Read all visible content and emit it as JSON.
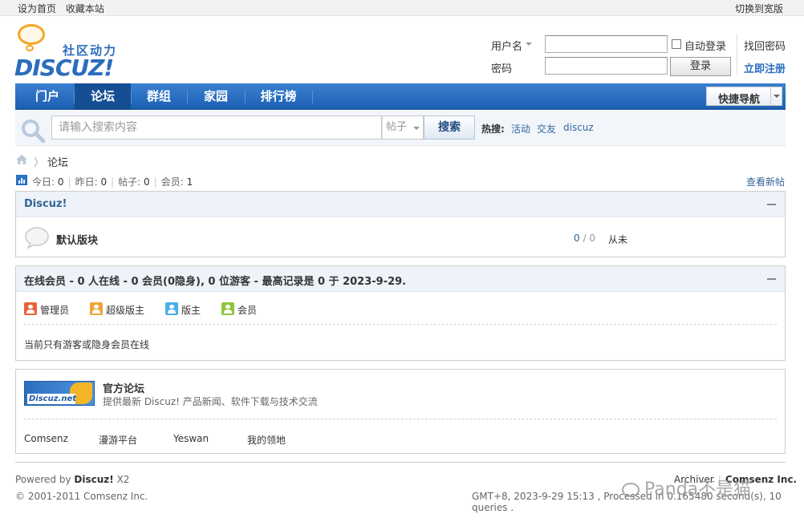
{
  "topbar": {
    "set_home": "设为首页",
    "bookmark": "收藏本站",
    "switch_width": "切换到宽版"
  },
  "logo": {
    "tagline": "社区动力",
    "wordmark": "DISCUZ!"
  },
  "login": {
    "username_label": "用户名",
    "password_label": "密码",
    "username_value": "",
    "password_value": "",
    "auto_login_label": "自动登录",
    "login_button": "登录",
    "forgot_password": "找回密码",
    "register": "立即注册"
  },
  "nav": {
    "items": [
      {
        "label": "门户",
        "active": false
      },
      {
        "label": "论坛",
        "active": true
      },
      {
        "label": "群组",
        "active": false
      },
      {
        "label": "家园",
        "active": false
      },
      {
        "label": "排行榜",
        "active": false
      }
    ],
    "quick_nav": "快捷导航"
  },
  "search": {
    "placeholder": "请输入搜索内容",
    "type": "帖子",
    "button": "搜索",
    "hot_label": "热搜:",
    "hot_terms": [
      "活动",
      "交友",
      "discuz"
    ]
  },
  "breadcrumb": {
    "separator": "〉",
    "current": "论坛"
  },
  "stats": {
    "today_label": "今日:",
    "today": "0",
    "yesterday_label": "昨日:",
    "yesterday": "0",
    "posts_label": "帖子:",
    "posts": "0",
    "members_label": "会员:",
    "members": "1",
    "new_posts_link": "查看新帖"
  },
  "category": {
    "name": "Discuz!",
    "forums": [
      {
        "name": "默认版块",
        "threads": "0",
        "posts": "0",
        "last_post": "从未"
      }
    ]
  },
  "online": {
    "title": "在线会员 - 0 人在线 - 0 会员(0隐身), 0 位游客 - 最高记录是 0 于 2023-9-29.",
    "legend": [
      {
        "label": "管理员",
        "color": "#e8623a"
      },
      {
        "label": "超级版主",
        "color": "#f0a43c"
      },
      {
        "label": "版主",
        "color": "#4aaee6"
      },
      {
        "label": "会员",
        "color": "#8cc63f"
      }
    ],
    "message": "当前只有游客或隐身会员在线"
  },
  "links": {
    "featured": {
      "logo_text": "Discuz.net",
      "title": "官方论坛",
      "desc": "提供最新 Discuz! 产品新闻、软件下载与技术交流"
    },
    "items": [
      "Comsenz",
      "漫游平台",
      "Yeswan",
      "我的领地"
    ]
  },
  "footer": {
    "powered_prefix": "Powered by",
    "powered_product": "Discuz!",
    "powered_version": "X2",
    "copyright": "© 2001-2011 Comsenz Inc.",
    "archiver": "Archiver",
    "company": "Comsenz Inc.",
    "runtime": "GMT+8, 2023-9-29 15:13 , Processed in 0.165480 second(s), 10 queries ."
  },
  "watermark": "Panda不是猫",
  "colors": {
    "nav": "#2a6fc4",
    "link": "#336699",
    "accent": "#f5a623"
  }
}
